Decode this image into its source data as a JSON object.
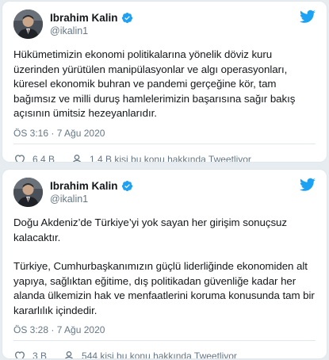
{
  "tweets": [
    {
      "author": {
        "name": "Ibrahim Kalin",
        "handle": "@ikalin1",
        "verified": true
      },
      "paragraphs": [
        "Hükümetimizin ekonomi politikalarına yönelik döviz kuru üzerinden yürütülen manipülasyonlar ve algı operasyonları, küresel ekonomik buhran ve pandemi gerçeğine kör, tam bağımsız ve milli duruş hamlelerimizin başarısına sağır bakış açısının ümitsiz hezeyanlarıdır."
      ],
      "timestamp": "ÖS 3:16 · 7 Ağu 2020",
      "likes": "6,4 B",
      "talking": "1,4 B kişi bu konu hakkında Tweetliyor"
    },
    {
      "author": {
        "name": "Ibrahim Kalin",
        "handle": "@ikalin1",
        "verified": true
      },
      "paragraphs": [
        "Doğu Akdeniz’de Türkiye’yi yok sayan her girişim sonuçsuz kalacaktır.",
        "Türkiye, Cumhurbaşkanımızın güçlü liderliğinde ekonomiden alt yapıya, sağlıktan eğitime, dış politikadan güvenliğe kadar her alanda ülkemizin hak ve menfaatlerini koruma konusunda tam bir kararlılık içindedir."
      ],
      "timestamp": "ÖS 3:28 · 7 Ağu 2020",
      "likes": "3 B",
      "talking": "544 kişi bu konu hakkında Tweetliyor"
    }
  ],
  "icons": {
    "brand": "twitter-bird-icon",
    "verified": "verified-badge-icon",
    "like": "heart-icon",
    "talking": "person-icon"
  },
  "colors": {
    "brand": "#1da1f2",
    "background": "#e6ecf0",
    "secondary_text": "#657786"
  }
}
